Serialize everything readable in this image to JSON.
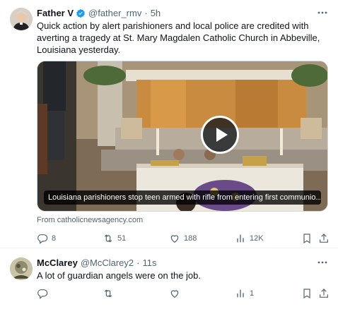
{
  "tweet1": {
    "name": "Father V",
    "handle": "@father_rmv",
    "dot": "·",
    "time": "5h",
    "text": "Quick action by alert parishioners and local police are credited with averting a tragedy at St. Mary Magdalen Catholic Church in Abbeville, Louisiana yesterday.",
    "media_caption": "Louisiana parishioners stop teen armed with rifle from entering first communio...",
    "source": "From catholicnewsagency.com",
    "stats": {
      "replies": "8",
      "reposts": "51",
      "likes": "188",
      "views": "12K"
    }
  },
  "tweet2": {
    "name": "McClarey",
    "handle": "@McClarey2",
    "dot": "·",
    "time": "11s",
    "text": "A lot of guardian angels were on the job.",
    "stats": {
      "views": "1"
    }
  },
  "icons": {
    "verified": "verified-badge-icon",
    "more": "more-options-icon",
    "reply": "reply-icon",
    "repost": "repost-icon",
    "like": "like-icon",
    "views": "views-icon",
    "bookmark": "bookmark-icon",
    "share": "share-icon",
    "play": "play-icon"
  },
  "colors": {
    "verified": "#1d9bf0",
    "secondary_text": "#536471",
    "primary_text": "#0f1419"
  }
}
